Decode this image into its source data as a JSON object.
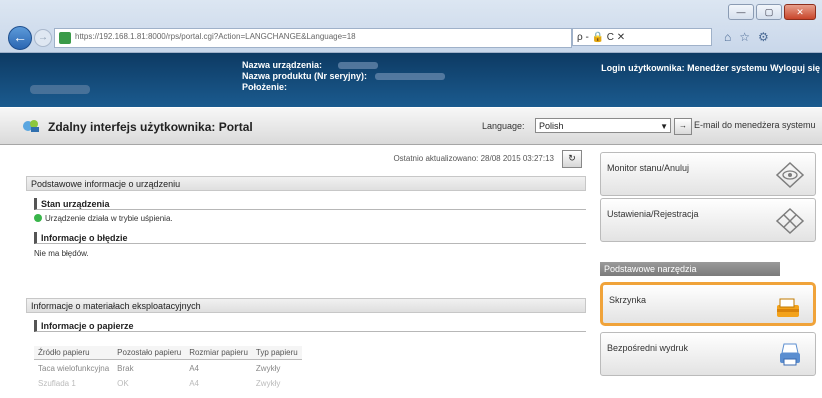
{
  "browser": {
    "url": "https://192.168.1.81:8000/rps/portal.cgi?Action=LANGCHANGE&Language=18",
    "search_placeholder": "ρ - 🔒 C ✕",
    "window_buttons": [
      "—",
      "▢",
      "✕"
    ],
    "tool_icons": [
      "home-icon",
      "star-icon",
      "gear-icon"
    ]
  },
  "header": {
    "device_name_label": "Nazwa urządzenia:",
    "product_name_label": "Nazwa produktu (Nr seryjny):",
    "location_label": "Położenie:",
    "login_text": "Login użytkownika: Menedżer systemu  Wyloguj się"
  },
  "titlebar": {
    "title": "Zdalny interfejs użytkownika: Portal",
    "language_label": "Language:",
    "language_value": "Polish",
    "go_label": "→",
    "mail_link": "E-mail do menedżera systemu"
  },
  "main": {
    "updated": "Ostatnio aktualizowano: 28/08 2015 03:27:13",
    "basic_info_head": "Podstawowe informacje o urządzeniu",
    "device_status_head": "Stan urządzenia",
    "device_status_text": "Urządzenie działa w trybie uśpienia.",
    "error_info_head": "Informacje o błędzie",
    "error_info_text": "Nie ma błędów.",
    "consumables_head": "Informacje o materiałach eksploatacyjnych",
    "paper_info_head": "Informacje o papierze",
    "paper_table": {
      "headers": [
        "Źródło papieru",
        "Pozostało papieru",
        "Rozmiar papieru",
        "Typ papieru"
      ],
      "rows": [
        [
          "Taca wielofunkcyjna",
          "Brak",
          "A4",
          "Zwykły"
        ],
        [
          "Szuflada 1",
          "OK",
          "A4",
          "Zwykły"
        ]
      ]
    }
  },
  "sidebar": {
    "monitor": "Monitor stanu/Anuluj",
    "settings": "Ustawienia/Rejestracja",
    "tools_head": "Podstawowe narzędzia",
    "mailbox": "Skrzynka",
    "direct_print": "Bezpośredni wydruk"
  },
  "colors": {
    "header_bg": "#0d3a63",
    "highlight": "#f0a33a",
    "status_green": "#39b54a"
  }
}
